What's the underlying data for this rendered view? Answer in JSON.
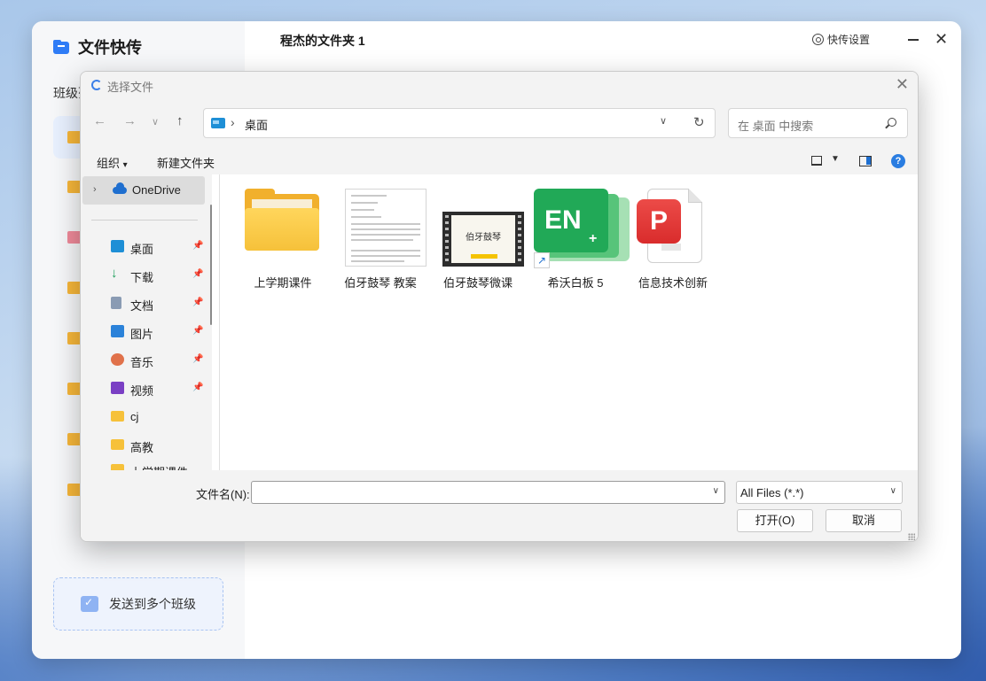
{
  "app": {
    "brand": "文件快传",
    "side_label": "班级列",
    "title": "程杰的文件夹 1",
    "settings_label": "快传设置",
    "send_button": "发送到多个班级"
  },
  "dialog": {
    "title": "选择文件",
    "address": {
      "location": "桌面"
    },
    "search_placeholder": "在 桌面 中搜索",
    "commands": {
      "organize": "组织",
      "organize_caret": "▾",
      "new_folder": "新建文件夹"
    },
    "nav": {
      "onedrive": "OneDrive",
      "quick_access": [
        {
          "label": "桌面",
          "icon": "desktop-icon",
          "pinned": true
        },
        {
          "label": "下载",
          "icon": "download-icon",
          "pinned": true
        },
        {
          "label": "文档",
          "icon": "document-icon",
          "pinned": true
        },
        {
          "label": "图片",
          "icon": "picture-icon",
          "pinned": true
        },
        {
          "label": "音乐",
          "icon": "music-icon",
          "pinned": true
        },
        {
          "label": "视频",
          "icon": "video-icon",
          "pinned": true
        },
        {
          "label": "cj",
          "icon": "folder-icon",
          "pinned": false
        },
        {
          "label": "高教",
          "icon": "folder-icon",
          "pinned": false
        },
        {
          "label": "上学期课件",
          "icon": "folder-icon",
          "pinned": false
        }
      ]
    },
    "files": [
      {
        "label": "上学期课件",
        "icon": "folder-icon"
      },
      {
        "label": "伯牙鼓琴 教案",
        "icon": "word-document-icon"
      },
      {
        "label": "伯牙鼓琴微课",
        "icon": "video-file-icon",
        "thumb_title": "伯牙鼓琴"
      },
      {
        "label": "希沃白板 5",
        "icon": "seewo-en-icon",
        "badge": "EN"
      },
      {
        "label": "信息技术创新",
        "icon": "pdf-reader-icon"
      }
    ],
    "filename_label": "文件名(N):",
    "filename_value": "",
    "filetype": "All Files (*.*)",
    "open_button": "打开(O)",
    "cancel_button": "取消"
  },
  "colors": {
    "accent": "#2f7cf6",
    "folder": "#f7b73a",
    "seewo_green": "#21a957",
    "pdf_red": "#e03a3a"
  }
}
